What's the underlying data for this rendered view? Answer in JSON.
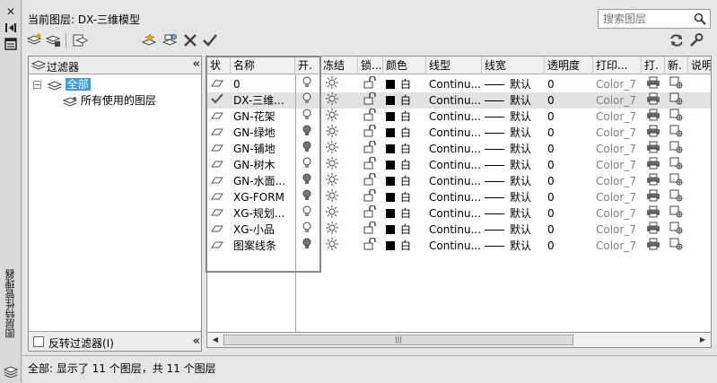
{
  "sidebar": {
    "vertical_title": "图层特性管理器"
  },
  "header": {
    "current_layer_label": "当前图层: DX-三维模型"
  },
  "search": {
    "placeholder": "搜索图层"
  },
  "filters": {
    "title": "过滤器",
    "tree_all": "全部",
    "tree_used": "所有使用的图层",
    "invert_label": "反转过滤器(I)"
  },
  "columns": [
    "状",
    "名称",
    "开.",
    "冻结",
    "锁...",
    "颜色",
    "线型",
    "线宽",
    "透明度",
    "打印...",
    "打.",
    "新.",
    "说明"
  ],
  "layers": [
    {
      "name": "0",
      "on": true,
      "color": "白",
      "linetype": "Continu...",
      "lineweight": "默认",
      "transparency": "0",
      "plot_style": "Color_7",
      "current": false
    },
    {
      "name": "DX-三维...",
      "on": true,
      "color": "白",
      "linetype": "Continu...",
      "lineweight": "默认",
      "transparency": "0",
      "plot_style": "Color_7",
      "current": true
    },
    {
      "name": "GN-花架",
      "on": true,
      "color": "白",
      "linetype": "Continu...",
      "lineweight": "默认",
      "transparency": "0",
      "plot_style": "Color_7",
      "current": false
    },
    {
      "name": "GN-绿地",
      "on": false,
      "color": "白",
      "linetype": "Continu...",
      "lineweight": "默认",
      "transparency": "0",
      "plot_style": "Color_7",
      "current": false
    },
    {
      "name": "GN-铺地",
      "on": false,
      "color": "白",
      "linetype": "Continu...",
      "lineweight": "默认",
      "transparency": "0",
      "plot_style": "Color_7",
      "current": false
    },
    {
      "name": "GN-树木",
      "on": true,
      "color": "白",
      "linetype": "Continu...",
      "lineweight": "默认",
      "transparency": "0",
      "plot_style": "Color_7",
      "current": false
    },
    {
      "name": "GN-水面...",
      "on": false,
      "color": "白",
      "linetype": "Continu...",
      "lineweight": "默认",
      "transparency": "0",
      "plot_style": "Color_7",
      "current": false
    },
    {
      "name": "XG-FORM",
      "on": false,
      "color": "白",
      "linetype": "Continu...",
      "lineweight": "默认",
      "transparency": "0",
      "plot_style": "Color_7",
      "current": false
    },
    {
      "name": "XG-规划...",
      "on": true,
      "color": "白",
      "linetype": "Continu...",
      "lineweight": "默认",
      "transparency": "0",
      "plot_style": "Color_7",
      "current": false
    },
    {
      "name": "XG-小品",
      "on": true,
      "color": "白",
      "linetype": "Continu...",
      "lineweight": "默认",
      "transparency": "0",
      "plot_style": "Color_7",
      "current": false
    },
    {
      "name": "图案线条",
      "on": false,
      "color": "白",
      "linetype": "Continu...",
      "lineweight": "默认",
      "transparency": "0",
      "plot_style": "Color_7",
      "current": false
    }
  ],
  "status": {
    "text": "全部: 显示了 11 个图层，共 11 个图层"
  },
  "icons": {
    "new_property_filter": "filter-new-icon",
    "new_group_filter": "group-filter-icon",
    "layer_states": "layer-states-icon",
    "new_layer": "new-layer-icon",
    "new_layer_frozen": "new-layer-vp-frozen-icon",
    "delete": "delete-icon",
    "set_current": "check-icon",
    "refresh": "refresh-icon",
    "settings": "wrench-icon"
  }
}
